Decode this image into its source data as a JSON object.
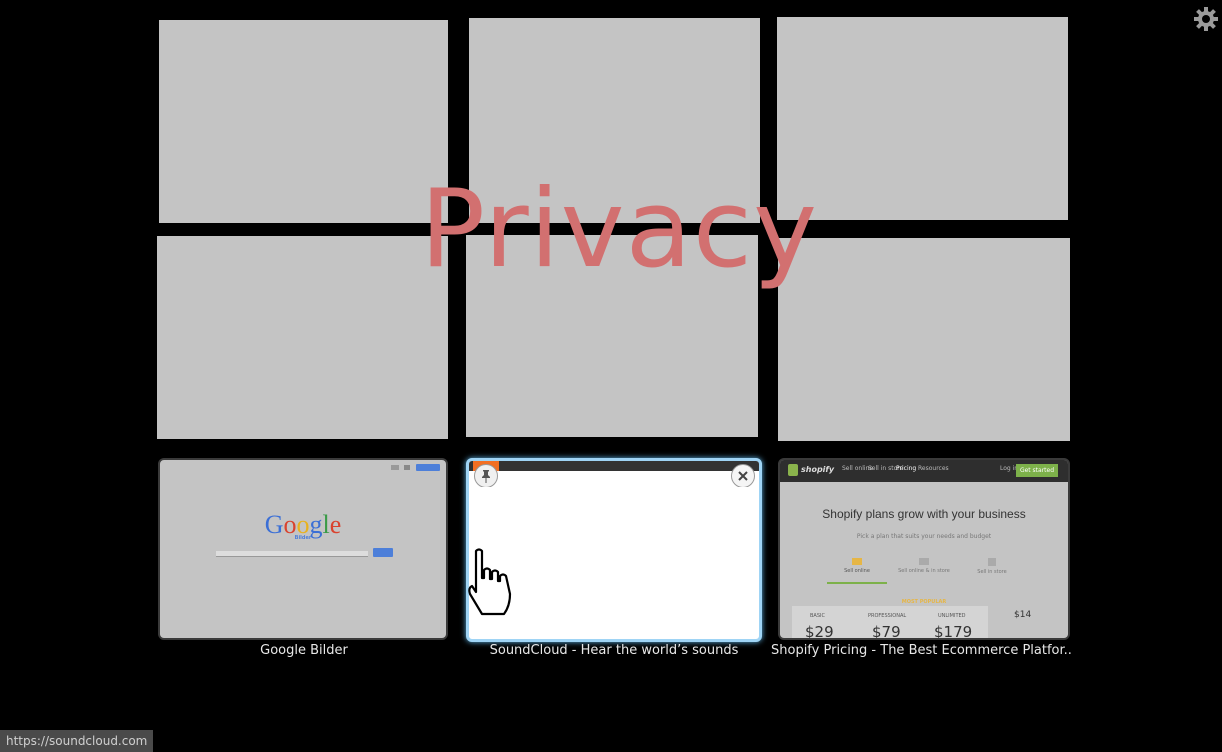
{
  "settings": {
    "icon": "gear-icon"
  },
  "overlay": {
    "text": "Privacy",
    "color": "#d27070"
  },
  "thumbnails": [
    {
      "caption": "Google Bilder",
      "google": {
        "logo": "Google",
        "sub": "Bilder"
      }
    },
    {
      "caption": "SoundCloud - Hear the world’s sounds"
    },
    {
      "caption": "Shopify Pricing - The Best Ecommerce Platfor...",
      "shopify": {
        "brand": "shopify",
        "nav": [
          "Sell online",
          "Sell in store",
          "Pricing",
          "Resources"
        ],
        "login": "Log in",
        "cta": "Get started",
        "headline": "Shopify plans grow with your business",
        "sub": "Pick a plan that suits your needs and budget",
        "options": [
          "Sell online",
          "Sell online & in store",
          "Sell in store"
        ],
        "popular": "MOST POPULAR",
        "plans": [
          {
            "name": "BASIC",
            "price": "$29"
          },
          {
            "name": "PROFESSIONAL",
            "price": "$79"
          },
          {
            "name": "UNLIMITED",
            "price": "$179"
          }
        ],
        "extra_price": "$14"
      }
    }
  ],
  "status_url": "https://soundcloud.com"
}
